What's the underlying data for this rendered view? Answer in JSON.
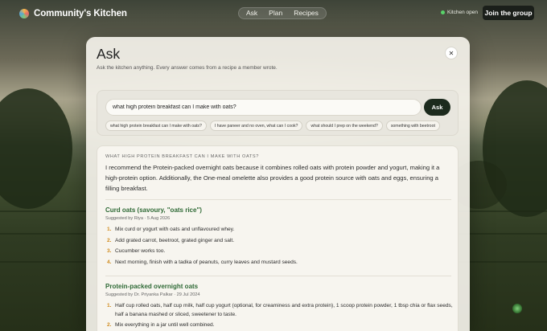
{
  "brand": {
    "name": "Community's Kitchen"
  },
  "nav": {
    "items": [
      "Ask",
      "Plan",
      "Recipes"
    ]
  },
  "status": {
    "text": "Kitchen open",
    "color": "#59d36a"
  },
  "join_button": {
    "label": "Join the group"
  },
  "modal": {
    "title": "Ask",
    "subtitle": "Ask the kitchen anything. Every answer comes from a recipe a member wrote.",
    "close_icon": "close-icon"
  },
  "ask": {
    "input_value": "what high protein breakfast can I make with oats?",
    "button_label": "Ask",
    "suggestions": [
      "what high protein breakfast can I make with oats?",
      "I have paneer and no oven, what can I cook?",
      "what should I prep on the weekend?",
      "something with beetroot"
    ]
  },
  "answer": {
    "question": "WHAT HIGH PROTEIN BREAKFAST CAN I MAKE WITH OATS?",
    "text": "I recommend the Protein-packed overnight oats because it combines rolled oats with protein powder and yogurt, making it a high-protein option. Additionally, the One-meal omelette also provides a good protein source with oats and eggs, ensuring a filling breakfast.",
    "recipes": [
      {
        "title": "Curd oats (savoury, \"oats rice\")",
        "meta": "Suggested by Riya · 5 Aug 2026",
        "steps": [
          "Mix curd or yogurt with oats and unflavoured whey.",
          "Add grated carrot, beetroot, grated ginger and salt.",
          "Cucumber works too.",
          "Next morning, finish with a tadka of peanuts, curry leaves and mustard seeds."
        ]
      },
      {
        "title": "Protein-packed overnight oats",
        "meta": "Suggested by Dr. Priyanka Palkar · 29 Jul 2024",
        "steps": [
          "Half cup rolled oats, half cup milk, half cup yogurt (optional, for creaminess and extra protein), 1 scoop protein powder, 1 tbsp chia or flax seeds, half a banana mashed or sliced, sweetener to taste.",
          "Mix everything in a jar until well combined."
        ]
      }
    ]
  },
  "colors": {
    "accent": "#2f6a36",
    "step_number": "#d08b1e",
    "button_dark": "#1c2a1d"
  }
}
